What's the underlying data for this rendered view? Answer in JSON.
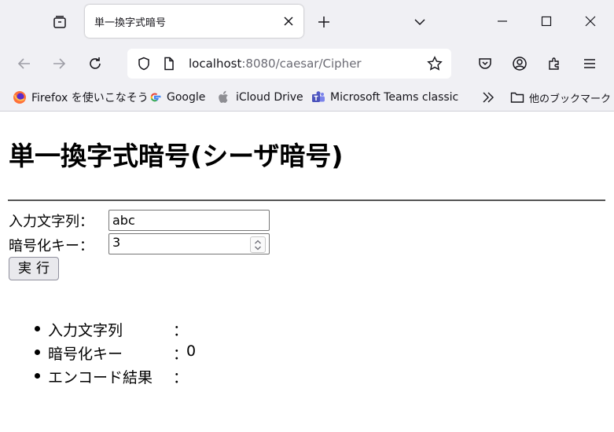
{
  "browser": {
    "tab_title": "単一換字式暗号",
    "url_host": "localhost",
    "url_rest": ":8080/caesar/Cipher",
    "bookmarks": [
      {
        "label": "Firefox を使いこなそう",
        "icon": "firefox-icon"
      },
      {
        "label": "Google",
        "icon": "google-icon"
      },
      {
        "label": "iCloud Drive",
        "icon": "apple-icon"
      },
      {
        "label": "Microsoft Teams classic",
        "icon": "teams-icon"
      }
    ],
    "other_bookmarks": "他のブックマーク"
  },
  "page": {
    "heading": "単一換字式暗号(シーザ暗号)",
    "input_label": "入力文字列：",
    "input_value": "abc",
    "key_label": "暗号化キー：",
    "key_value": "3",
    "run_button": "実行",
    "results": [
      {
        "label": "入力文字列",
        "colon": "：",
        "value": ""
      },
      {
        "label": "暗号化キー",
        "colon": "：",
        "value": "0"
      },
      {
        "label": "エンコード結果",
        "colon": "：",
        "value": ""
      }
    ]
  }
}
